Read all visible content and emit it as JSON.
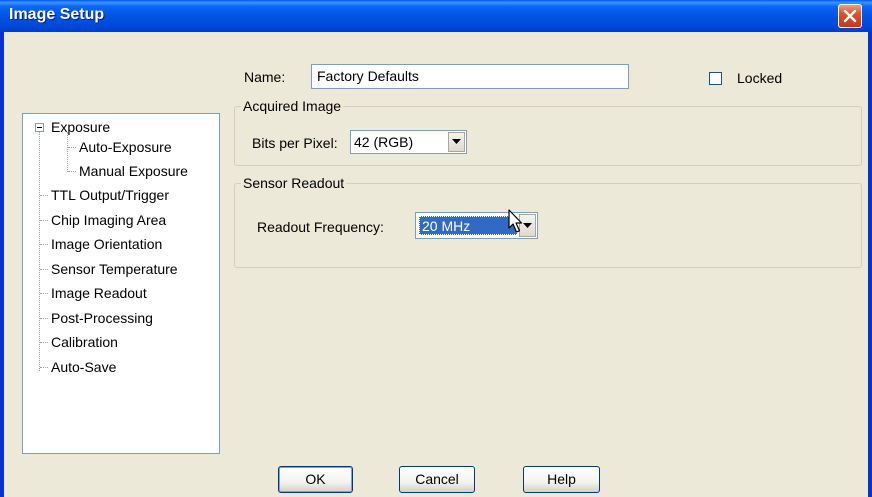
{
  "window": {
    "title": "Image Setup"
  },
  "form": {
    "name_label": "Name:",
    "name_value": "Factory Defaults",
    "locked_label": "Locked",
    "locked_checked": false
  },
  "acquired_image": {
    "legend": "Acquired Image",
    "bits_label": "Bits per Pixel:",
    "bits_value": "42 (RGB)"
  },
  "sensor_readout": {
    "legend": "Sensor Readout",
    "frequency_label": "Readout Frequency:",
    "frequency_value": "20 MHz"
  },
  "tree": {
    "items": [
      {
        "label": "Exposure",
        "level": 0,
        "expanded": true
      },
      {
        "label": "Auto-Exposure",
        "level": 1
      },
      {
        "label": "Manual Exposure",
        "level": 1
      },
      {
        "label": "TTL Output/Trigger",
        "level": 0
      },
      {
        "label": "Chip Imaging Area",
        "level": 0
      },
      {
        "label": "Image Orientation",
        "level": 0
      },
      {
        "label": "Sensor Temperature",
        "level": 0
      },
      {
        "label": "Image Readout",
        "level": 0,
        "selected": true
      },
      {
        "label": "Post-Processing",
        "level": 0
      },
      {
        "label": "Calibration",
        "level": 0
      },
      {
        "label": "Auto-Save",
        "level": 0
      }
    ]
  },
  "buttons": {
    "ok": "OK",
    "cancel": "Cancel",
    "help": "Help"
  },
  "colors": {
    "titlebar": "#0054e3",
    "dialog_bg": "#ece9d8",
    "selection": "#316ac5",
    "close_button": "#e0502c"
  },
  "icons": [
    "close-icon",
    "dropdown-arrow-icon",
    "checkbox-icon",
    "tree-collapse-icon",
    "mouse-pointer-icon"
  ]
}
